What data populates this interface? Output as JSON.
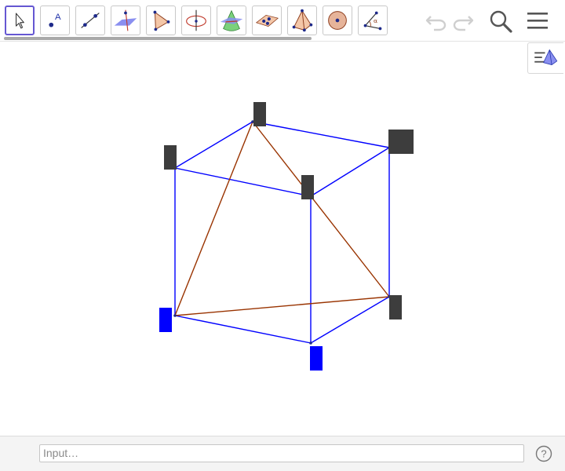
{
  "toolbar": {
    "tools": [
      {
        "name": "move-tool",
        "selected": true
      },
      {
        "name": "point-tool",
        "selected": false
      },
      {
        "name": "line-tool",
        "selected": false
      },
      {
        "name": "perpendicular-plane-tool",
        "selected": false
      },
      {
        "name": "polygon-tool",
        "selected": false
      },
      {
        "name": "circle-around-axis-tool",
        "selected": false
      },
      {
        "name": "intersect-surfaces-tool",
        "selected": false
      },
      {
        "name": "plane-through-points-tool",
        "selected": false
      },
      {
        "name": "pyramid-tool",
        "selected": false
      },
      {
        "name": "sphere-tool",
        "selected": false
      },
      {
        "name": "angle-tool",
        "selected": false
      }
    ],
    "icons": {
      "undo": "undo-icon",
      "redo": "redo-icon",
      "search": "search-icon",
      "menu": "menu-icon",
      "view": "graphics-3d-view-icon"
    },
    "accent": "#6557d2"
  },
  "scene": {
    "edge_color": "#0000ff",
    "section_color": "#993300",
    "label_box_color": "#3d3d3d",
    "label_box_highlight": "#0000ff"
  },
  "input": {
    "placeholder": "Input…"
  }
}
